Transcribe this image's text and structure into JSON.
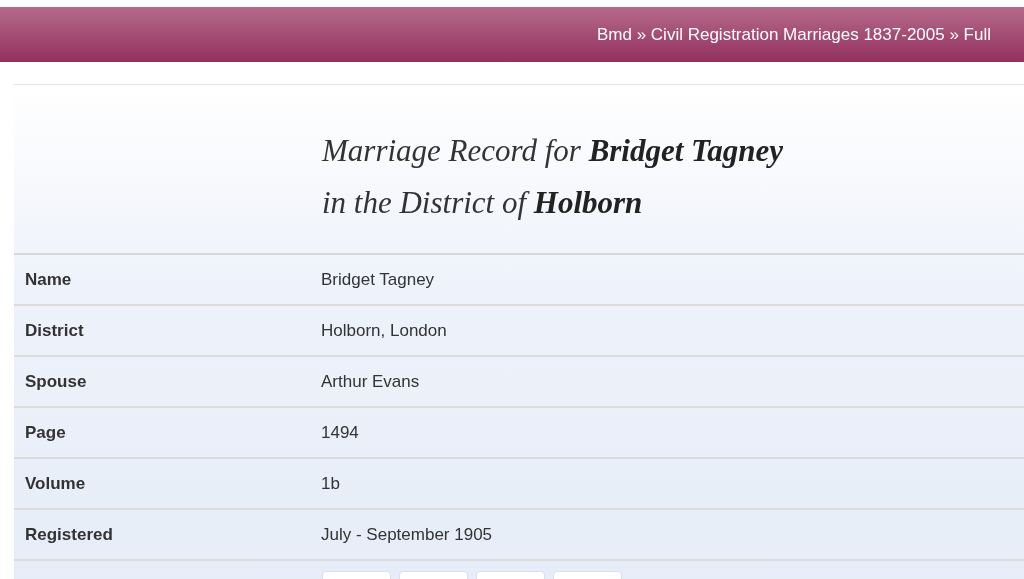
{
  "breadcrumb": "Bmd » Civil Registration Marriages 1837-2005 » Full",
  "title_lines": [
    "Marriage Record for **Bridget Tagney**",
    "in the District of **Holborn**"
  ],
  "rows": [
    {
      "label": "Name",
      "value": "Bridget Tagney"
    },
    {
      "label": "District",
      "value": "Holborn, London"
    },
    {
      "label": "Spouse",
      "value": "Arthur Evans"
    },
    {
      "label": "Page",
      "value": "1494"
    },
    {
      "label": "Volume",
      "value": "1b"
    },
    {
      "label": "Registered",
      "value": "July - September 1905"
    }
  ],
  "buttons": [
    {
      "kind": "button"
    },
    {
      "kind": "button"
    },
    {
      "kind": "button"
    },
    {
      "kind": "button"
    }
  ]
}
